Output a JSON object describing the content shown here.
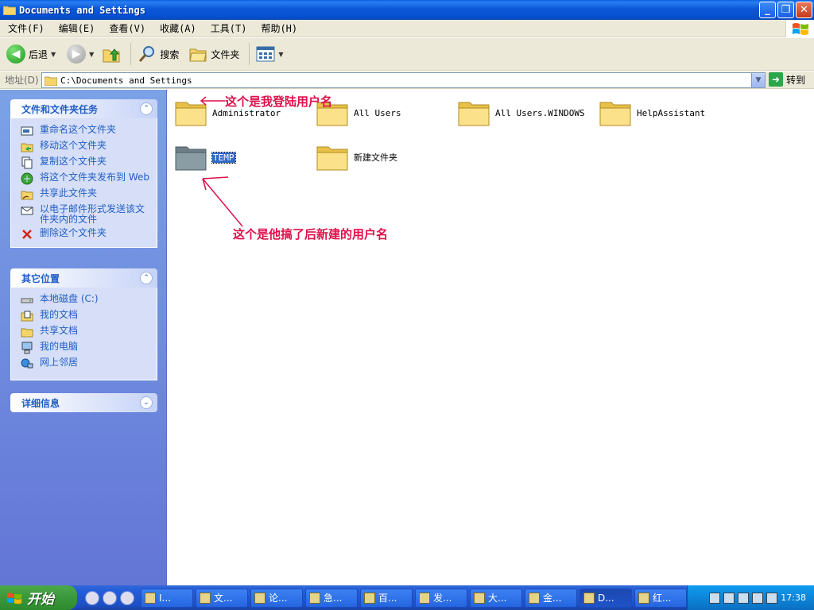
{
  "window": {
    "title": "Documents and Settings",
    "controls": {
      "minimize": "_",
      "maximize": "❐",
      "close": "✕"
    }
  },
  "menu": {
    "items": [
      "文件(F)",
      "编辑(E)",
      "查看(V)",
      "收藏(A)",
      "工具(T)",
      "帮助(H)"
    ]
  },
  "toolbar": {
    "back": "后退",
    "search": "搜索",
    "folders": "文件夹"
  },
  "address": {
    "label": "地址(D)",
    "value": "C:\\Documents and Settings",
    "go": "转到"
  },
  "taskpane": {
    "file_tasks": {
      "title": "文件和文件夹任务",
      "items": [
        {
          "label": "重命名这个文件夹",
          "icon": "rename-icon"
        },
        {
          "label": "移动这个文件夹",
          "icon": "move-icon"
        },
        {
          "label": "复制这个文件夹",
          "icon": "copy-icon"
        },
        {
          "label": "将这个文件夹发布到 Web",
          "icon": "publish-web-icon"
        },
        {
          "label": "共享此文件夹",
          "icon": "share-icon"
        },
        {
          "label": "以电子邮件形式发送该文件夹内的文件",
          "icon": "email-icon"
        },
        {
          "label": "删除这个文件夹",
          "icon": "delete-icon"
        }
      ]
    },
    "other_places": {
      "title": "其它位置",
      "items": [
        {
          "label": "本地磁盘 (C:)",
          "icon": "disk-icon"
        },
        {
          "label": "我的文档",
          "icon": "my-documents-icon"
        },
        {
          "label": "共享文档",
          "icon": "shared-documents-icon"
        },
        {
          "label": "我的电脑",
          "icon": "my-computer-icon"
        },
        {
          "label": "网上邻居",
          "icon": "network-icon"
        }
      ]
    },
    "details": {
      "title": "详细信息"
    }
  },
  "folders": [
    {
      "name": "Administrator"
    },
    {
      "name": "All Users"
    },
    {
      "name": "All Users.WINDOWS"
    },
    {
      "name": "HelpAssistant"
    },
    {
      "name": "TEMP"
    },
    {
      "name": "新建文件夹"
    }
  ],
  "annotations": {
    "top": "这个是我登陆用户名",
    "bottom": "这个是他搞了后新建的用户名",
    "color": "#e0104a"
  },
  "taskbar": {
    "start": "开始",
    "buttons": [
      "I...",
      "文...",
      "论...",
      "急...",
      "百...",
      "发...",
      "大...",
      "金...",
      "D...",
      "红..."
    ],
    "clock": "17:38"
  }
}
